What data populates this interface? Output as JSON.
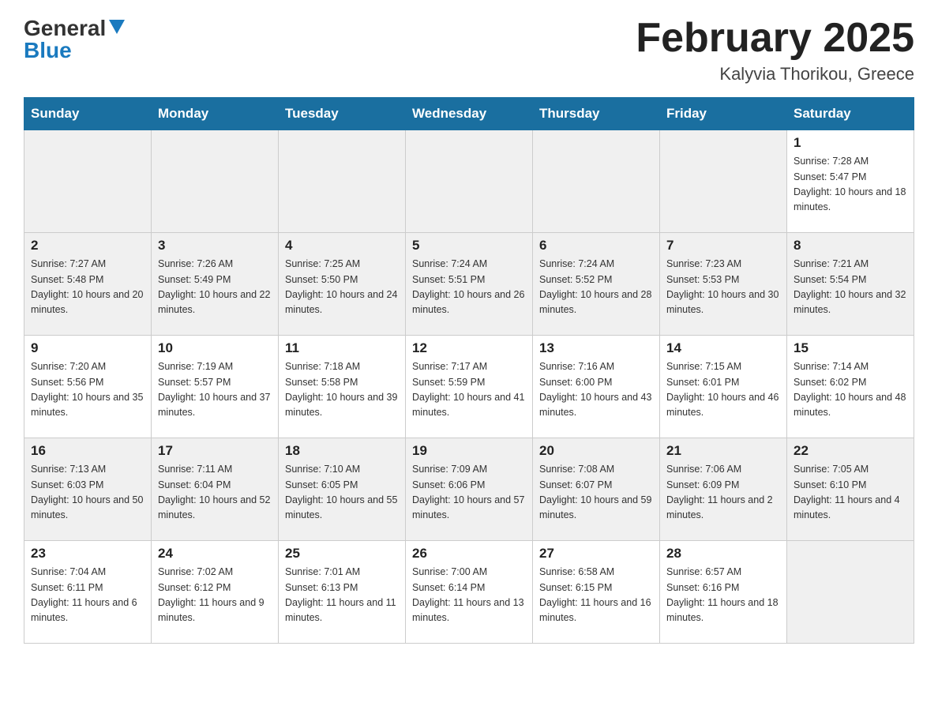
{
  "header": {
    "logo_general": "General",
    "logo_blue": "Blue",
    "month_title": "February 2025",
    "location": "Kalyvia Thorikou, Greece"
  },
  "days_of_week": [
    "Sunday",
    "Monday",
    "Tuesday",
    "Wednesday",
    "Thursday",
    "Friday",
    "Saturday"
  ],
  "weeks": [
    [
      {
        "day": "",
        "info": ""
      },
      {
        "day": "",
        "info": ""
      },
      {
        "day": "",
        "info": ""
      },
      {
        "day": "",
        "info": ""
      },
      {
        "day": "",
        "info": ""
      },
      {
        "day": "",
        "info": ""
      },
      {
        "day": "1",
        "info": "Sunrise: 7:28 AM\nSunset: 5:47 PM\nDaylight: 10 hours and 18 minutes."
      }
    ],
    [
      {
        "day": "2",
        "info": "Sunrise: 7:27 AM\nSunset: 5:48 PM\nDaylight: 10 hours and 20 minutes."
      },
      {
        "day": "3",
        "info": "Sunrise: 7:26 AM\nSunset: 5:49 PM\nDaylight: 10 hours and 22 minutes."
      },
      {
        "day": "4",
        "info": "Sunrise: 7:25 AM\nSunset: 5:50 PM\nDaylight: 10 hours and 24 minutes."
      },
      {
        "day": "5",
        "info": "Sunrise: 7:24 AM\nSunset: 5:51 PM\nDaylight: 10 hours and 26 minutes."
      },
      {
        "day": "6",
        "info": "Sunrise: 7:24 AM\nSunset: 5:52 PM\nDaylight: 10 hours and 28 minutes."
      },
      {
        "day": "7",
        "info": "Sunrise: 7:23 AM\nSunset: 5:53 PM\nDaylight: 10 hours and 30 minutes."
      },
      {
        "day": "8",
        "info": "Sunrise: 7:21 AM\nSunset: 5:54 PM\nDaylight: 10 hours and 32 minutes."
      }
    ],
    [
      {
        "day": "9",
        "info": "Sunrise: 7:20 AM\nSunset: 5:56 PM\nDaylight: 10 hours and 35 minutes."
      },
      {
        "day": "10",
        "info": "Sunrise: 7:19 AM\nSunset: 5:57 PM\nDaylight: 10 hours and 37 minutes."
      },
      {
        "day": "11",
        "info": "Sunrise: 7:18 AM\nSunset: 5:58 PM\nDaylight: 10 hours and 39 minutes."
      },
      {
        "day": "12",
        "info": "Sunrise: 7:17 AM\nSunset: 5:59 PM\nDaylight: 10 hours and 41 minutes."
      },
      {
        "day": "13",
        "info": "Sunrise: 7:16 AM\nSunset: 6:00 PM\nDaylight: 10 hours and 43 minutes."
      },
      {
        "day": "14",
        "info": "Sunrise: 7:15 AM\nSunset: 6:01 PM\nDaylight: 10 hours and 46 minutes."
      },
      {
        "day": "15",
        "info": "Sunrise: 7:14 AM\nSunset: 6:02 PM\nDaylight: 10 hours and 48 minutes."
      }
    ],
    [
      {
        "day": "16",
        "info": "Sunrise: 7:13 AM\nSunset: 6:03 PM\nDaylight: 10 hours and 50 minutes."
      },
      {
        "day": "17",
        "info": "Sunrise: 7:11 AM\nSunset: 6:04 PM\nDaylight: 10 hours and 52 minutes."
      },
      {
        "day": "18",
        "info": "Sunrise: 7:10 AM\nSunset: 6:05 PM\nDaylight: 10 hours and 55 minutes."
      },
      {
        "day": "19",
        "info": "Sunrise: 7:09 AM\nSunset: 6:06 PM\nDaylight: 10 hours and 57 minutes."
      },
      {
        "day": "20",
        "info": "Sunrise: 7:08 AM\nSunset: 6:07 PM\nDaylight: 10 hours and 59 minutes."
      },
      {
        "day": "21",
        "info": "Sunrise: 7:06 AM\nSunset: 6:09 PM\nDaylight: 11 hours and 2 minutes."
      },
      {
        "day": "22",
        "info": "Sunrise: 7:05 AM\nSunset: 6:10 PM\nDaylight: 11 hours and 4 minutes."
      }
    ],
    [
      {
        "day": "23",
        "info": "Sunrise: 7:04 AM\nSunset: 6:11 PM\nDaylight: 11 hours and 6 minutes."
      },
      {
        "day": "24",
        "info": "Sunrise: 7:02 AM\nSunset: 6:12 PM\nDaylight: 11 hours and 9 minutes."
      },
      {
        "day": "25",
        "info": "Sunrise: 7:01 AM\nSunset: 6:13 PM\nDaylight: 11 hours and 11 minutes."
      },
      {
        "day": "26",
        "info": "Sunrise: 7:00 AM\nSunset: 6:14 PM\nDaylight: 11 hours and 13 minutes."
      },
      {
        "day": "27",
        "info": "Sunrise: 6:58 AM\nSunset: 6:15 PM\nDaylight: 11 hours and 16 minutes."
      },
      {
        "day": "28",
        "info": "Sunrise: 6:57 AM\nSunset: 6:16 PM\nDaylight: 11 hours and 18 minutes."
      },
      {
        "day": "",
        "info": ""
      }
    ]
  ]
}
